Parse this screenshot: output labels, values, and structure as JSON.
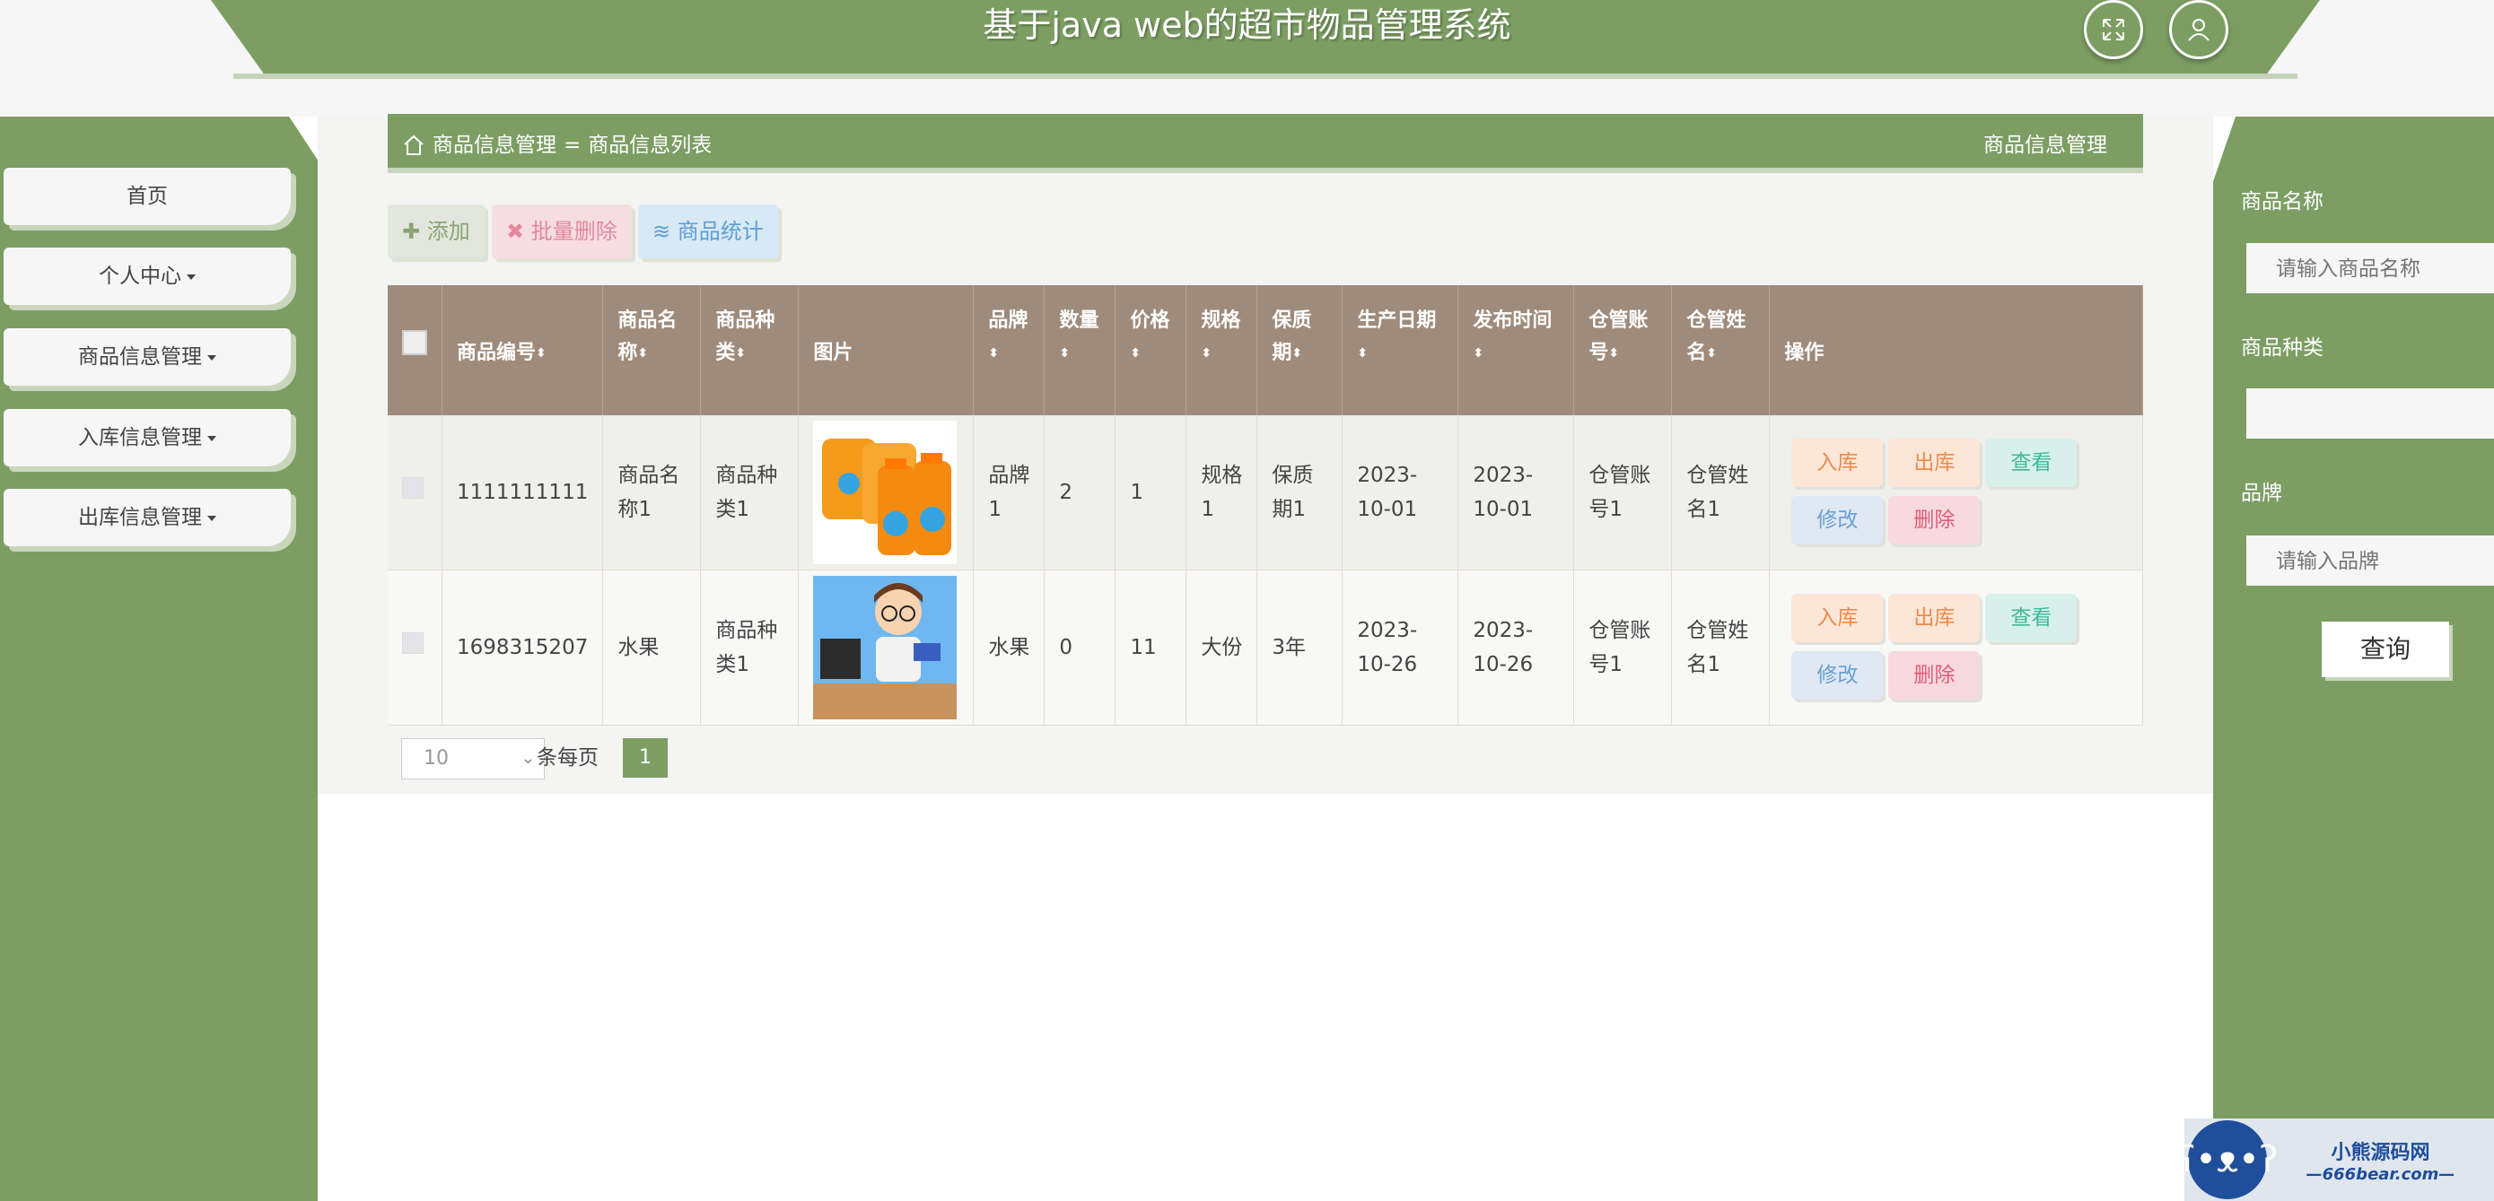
{
  "header": {
    "title": "基于java web的超市物品管理系统",
    "fullscreen_icon": "fullscreen-icon",
    "user_icon": "user-icon"
  },
  "sidebar": {
    "items": [
      {
        "label": "首页",
        "has_caret": false
      },
      {
        "label": "个人中心",
        "has_caret": true
      },
      {
        "label": "商品信息管理",
        "has_caret": true
      },
      {
        "label": "入库信息管理",
        "has_caret": true
      },
      {
        "label": "出库信息管理",
        "has_caret": true
      }
    ]
  },
  "breadcrumb": {
    "home_icon": "home-icon",
    "level1": "商品信息管理",
    "separator": "=",
    "level2": "商品信息列表",
    "right": "商品信息管理"
  },
  "toolbar": {
    "add_label": "添加",
    "batch_delete_label": "批量删除",
    "stats_label": "商品统计"
  },
  "table": {
    "headers": {
      "code": "商品编号",
      "name": "商品名称",
      "kind": "商品种类",
      "image": "图片",
      "brand": "品牌",
      "qty": "数量",
      "price": "价格",
      "spec": "规格",
      "shelf": "保质期",
      "prod_date": "生产日期",
      "pub_time": "发布时间",
      "wh_account": "仓管账号",
      "wh_name": "仓管姓名",
      "ops": "操作"
    },
    "rows": [
      {
        "code": "1111111111",
        "name": "商品名称1",
        "kind": "商品种类1",
        "image": "orange-juice-bottles",
        "brand": "品牌1",
        "qty": "2",
        "price": "1",
        "spec": "规格1",
        "shelf": "保质期1",
        "prod_date": "2023-10-01",
        "pub_time": "2023-10-01",
        "wh_account": "仓管账号1",
        "wh_name": "仓管姓名1"
      },
      {
        "code": "1698315207",
        "name": "水果",
        "kind": "商品种类1",
        "image": "cartoon-programmer",
        "brand": "水果",
        "qty": "0",
        "price": "11",
        "spec": "大份",
        "shelf": "3年",
        "prod_date": "2023-10-26",
        "pub_time": "2023-10-26",
        "wh_account": "仓管账号1",
        "wh_name": "仓管姓名1"
      }
    ],
    "actions": {
      "in": "入库",
      "out": "出库",
      "view": "查看",
      "edit": "修改",
      "delete": "删除"
    }
  },
  "pagination": {
    "page_size": "10",
    "per_page_label": "条每页",
    "current_page": "1"
  },
  "search": {
    "name_label": "商品名称",
    "name_placeholder": "请输入商品名称",
    "kind_label": "商品种类",
    "kind_value": "",
    "brand_label": "品牌",
    "brand_placeholder": "请输入品牌",
    "query_label": "查询"
  },
  "watermark": {
    "line1": "小熊源码网",
    "line2": "—666bear.com—"
  },
  "colors": {
    "primary": "#7c9e63",
    "table_header": "#9e8b7b",
    "content_bg": "#f4f4f3"
  }
}
